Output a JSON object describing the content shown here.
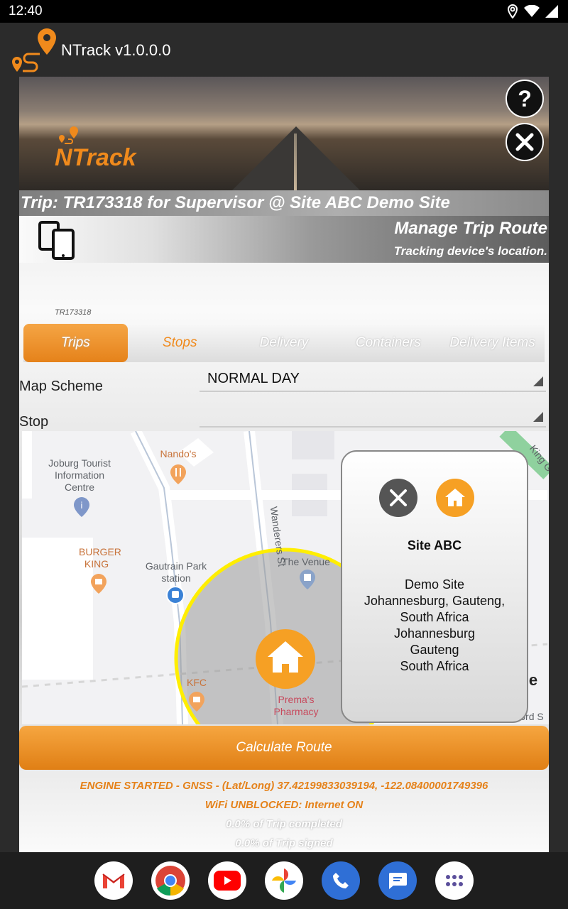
{
  "status_bar": {
    "time": "12:40"
  },
  "app": {
    "title": "NTrack v1.0.0.0",
    "brand": "NTrack"
  },
  "header": {
    "trip_line": "Trip: TR173318 for Supervisor @ Site ABC Demo Site",
    "manage_title": "Manage Trip Route",
    "manage_subtitle": "Tracking device's location.",
    "help_label": "?",
    "trip_id": "TR173318"
  },
  "tabs": [
    "Trips",
    "Stops",
    "Delivery",
    "Containers",
    "Delivery Items"
  ],
  "form": {
    "map_scheme_label": "Map Scheme",
    "map_scheme_value": "NORMAL DAY",
    "stop_label": "Stop",
    "stop_value": ""
  },
  "map": {
    "labels": {
      "tourist": "Joburg Tourist Information Centre",
      "nandos": "Nando's",
      "burger": "BURGER KING",
      "gautrain": "Gautrain Park station",
      "wanderers": "Wanderers St",
      "venue": "The Venue",
      "kfc": "KFC",
      "pharmacy": "Prema's Pharmacy",
      "king": "King G",
      "edge_e": "e",
      "edge_s": "ord S"
    },
    "popup": {
      "title": "Site ABC",
      "address_lines": [
        "Demo Site",
        "Johannesburg, Gauteng,",
        "South Africa",
        "Johannesburg",
        "Gauteng",
        "South Africa"
      ]
    }
  },
  "actions": {
    "calculate": "Calculate Route"
  },
  "status_lines": {
    "engine": "ENGINE STARTED - GNSS - (Lat/Long) 37.42199833039194, -122.08400001749396",
    "wifi": "WiFi UNBLOCKED: Internet ON",
    "trip_completed": "0.0% of Trip completed",
    "trip_signed": "0.0% of Trip signed"
  },
  "colors": {
    "accent": "#f08a1c",
    "appbar": "#2b2b2b",
    "geofence": "#ffee00"
  },
  "dock_apps": [
    "Gmail",
    "Chrome",
    "YouTube",
    "Photos",
    "Phone",
    "Messages",
    "Apps"
  ]
}
